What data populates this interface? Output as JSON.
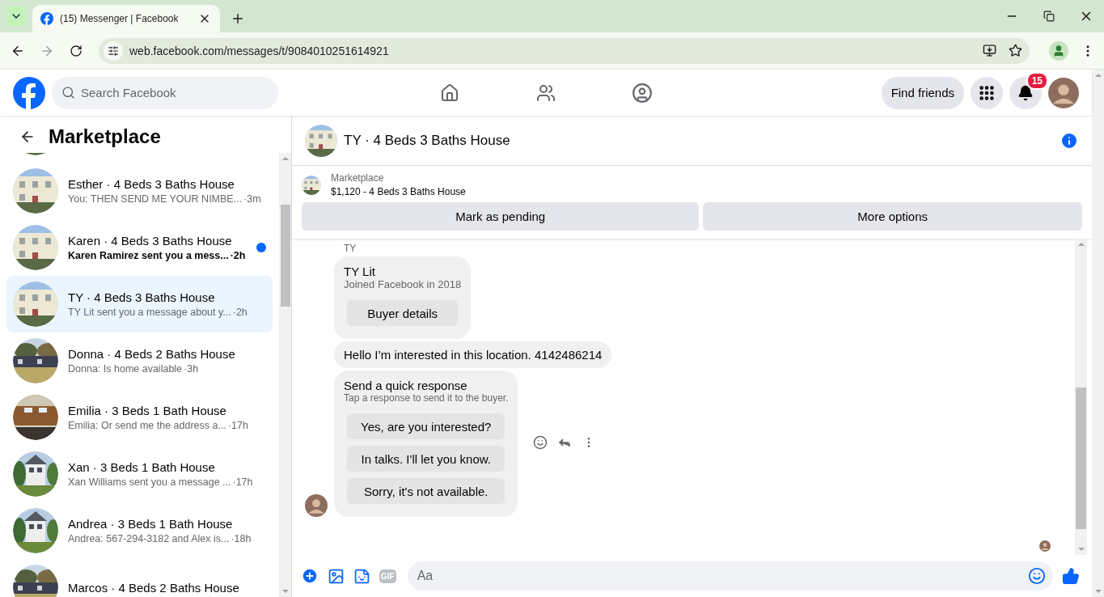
{
  "browser": {
    "tab_title": "(15) Messenger | Facebook",
    "url": "web.facebook.com/messages/t/9084010251614921"
  },
  "header": {
    "search": {
      "placeholder": "Search Facebook"
    },
    "find_friends": "Find friends",
    "notification_count": "15"
  },
  "sidebar": {
    "title": "Marketplace",
    "conversations": [
      {
        "title": "Esther · 4 Beds 3 Baths House",
        "preview": "You: THEN SEND ME YOUR NIMBE...",
        "time": "·3m",
        "unread": false,
        "selected": false
      },
      {
        "title": "Karen · 4 Beds 3 Baths House",
        "preview": "Karen Ramirez sent you a mess...",
        "time": "·2h",
        "unread": true,
        "selected": false
      },
      {
        "title": "TY · 4 Beds 3 Baths House",
        "preview": "TY Lit sent you a message about y...",
        "time": "·2h",
        "unread": false,
        "selected": true
      },
      {
        "title": "Donna · 4 Beds 2 Baths House",
        "preview": "Donna: Is home available",
        "time": "·3h",
        "unread": false,
        "selected": false
      },
      {
        "title": "Emilia · 3 Beds 1 Bath House",
        "preview": "Emilia: Or send me the address a...",
        "time": "·17h",
        "unread": false,
        "selected": false
      },
      {
        "title": "Xan · 3 Beds 1 Bath House",
        "preview": "Xan Williams sent you a message ...",
        "time": "·17h",
        "unread": false,
        "selected": false
      },
      {
        "title": "Andrea · 3 Beds 1 Bath House",
        "preview": "Andrea: 567-294-3182 and Alex is...",
        "time": "·18h",
        "unread": false,
        "selected": false
      },
      {
        "title": "Marcos · 4 Beds 2 Baths House",
        "selected": false
      }
    ]
  },
  "conversation": {
    "title": "TY · 4 Beds 3 Baths House",
    "listing": {
      "label": "Marketplace",
      "text": "$1,120 - 4 Beds 3 Baths House",
      "buttons": [
        "Mark as pending",
        "More options"
      ]
    },
    "sender": "TY",
    "buyer_card": {
      "name": "TY Lit",
      "joined": "Joined Facebook in 2018",
      "button": "Buyer details"
    },
    "message": "Hello I’m interested in this location. 4142486214",
    "quick_response": {
      "title": "Send a quick response",
      "subtitle": "Tap a response to send it to the buyer.",
      "options": [
        "Yes, are you interested?",
        "In talks. I'll let you know.",
        "Sorry, it's not available."
      ]
    },
    "composer": {
      "gif": "GIF",
      "placeholder": "Aa"
    }
  }
}
